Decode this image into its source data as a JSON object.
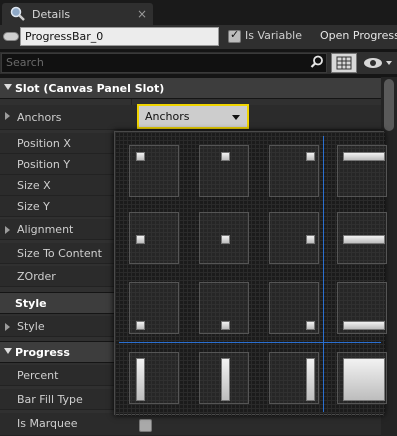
{
  "tab": {
    "label": "Details",
    "close": "×"
  },
  "header": {
    "name_value": "ProgressBar_0",
    "is_variable_label": "Is Variable",
    "is_variable_checked": true,
    "open_label": "Open Progress"
  },
  "search": {
    "placeholder": "Search"
  },
  "categories": {
    "slot": "Slot (Canvas Panel Slot)",
    "style": "Style",
    "progress": "Progress"
  },
  "properties": {
    "anchors": "Anchors",
    "position_x": "Position X",
    "position_y": "Position Y",
    "size_x": "Size X",
    "size_y": "Size Y",
    "alignment": "Alignment",
    "size_to_content": "Size To Content",
    "zorder": "ZOrder",
    "style": "Style",
    "percent": "Percent",
    "bar_fill_type": "Bar Fill Type",
    "is_marquee": "Is Marquee"
  },
  "anchors_combo": {
    "value": "Anchors"
  },
  "anchor_presets": [
    "top-left",
    "top-center",
    "top-right",
    "top-stretch",
    "center-left",
    "center",
    "center-right",
    "center-stretch",
    "bottom-left",
    "bottom-center",
    "bottom-right",
    "bottom-stretch",
    "left-stretch",
    "center-vertical-stretch",
    "right-stretch",
    "fill"
  ],
  "colors": {
    "highlight": "#f0d400",
    "guide_line": "#2a6fd0"
  }
}
